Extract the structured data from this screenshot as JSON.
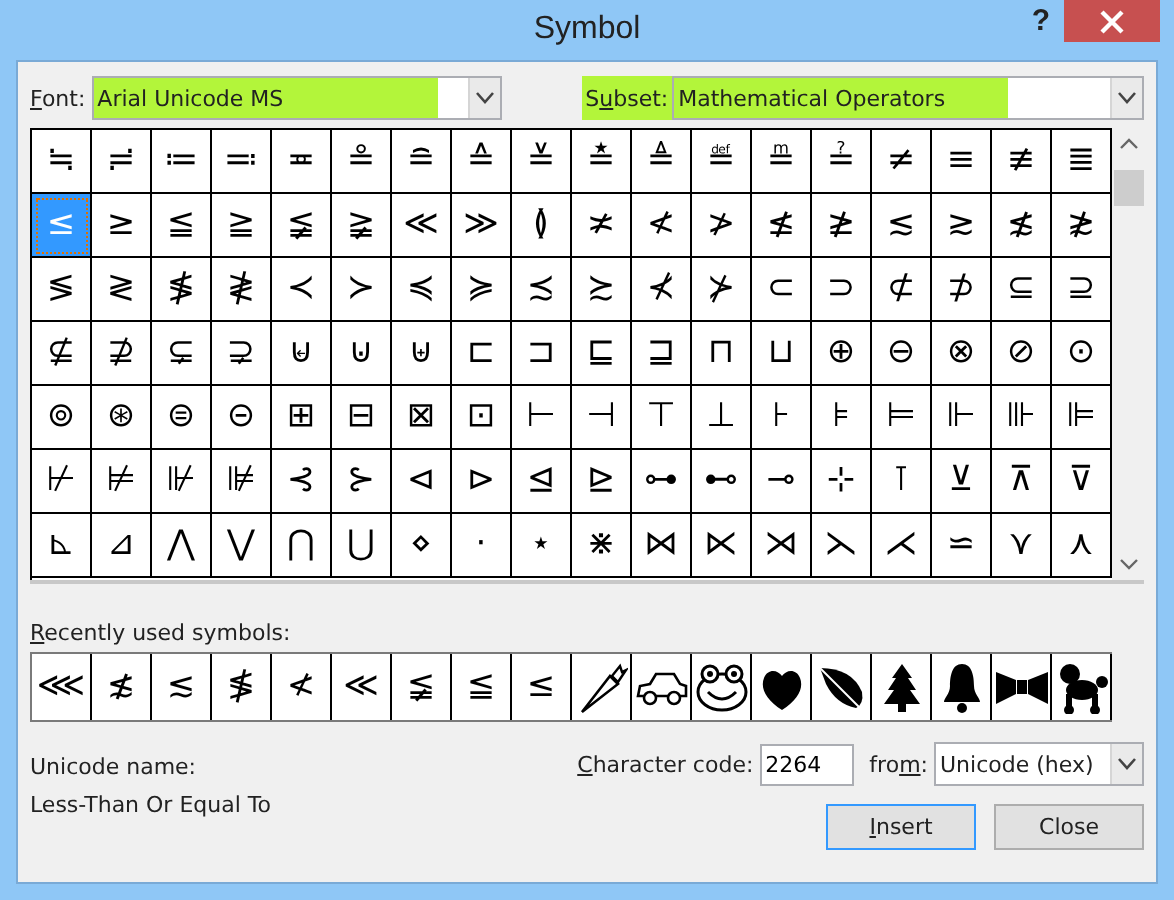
{
  "window": {
    "title": "Symbol",
    "help": "?"
  },
  "font": {
    "label": {
      "key": "F",
      "after": "ont:"
    },
    "value": "Arial Unicode MS"
  },
  "subset": {
    "label": {
      "before": "S",
      "key": "u",
      "after": "bset:"
    },
    "value": "Mathematical Operators"
  },
  "grid": [
    [
      {
        "symbol": "≒",
        "selected": false
      },
      {
        "symbol": "≓",
        "selected": false
      },
      {
        "symbol": "≔",
        "selected": false
      },
      {
        "symbol": "≕",
        "selected": false
      },
      {
        "symbol": "≖",
        "selected": false
      },
      {
        "symbol": "≗",
        "selected": false
      },
      {
        "symbol": "≘",
        "selected": false
      },
      {
        "symbol": "≙",
        "selected": false
      },
      {
        "symbol": "≚",
        "selected": false
      },
      {
        "symbol": "≛",
        "selected": false
      },
      {
        "symbol": "≜",
        "selected": false
      },
      {
        "symbol": "≝",
        "selected": false
      },
      {
        "symbol": "≞",
        "selected": false
      },
      {
        "symbol": "≟",
        "selected": false
      },
      {
        "symbol": "≠",
        "selected": false
      },
      {
        "symbol": "≡",
        "selected": false
      },
      {
        "symbol": "≢",
        "selected": false
      },
      {
        "symbol": "≣",
        "selected": false
      }
    ],
    [
      {
        "symbol": "≤",
        "selected": true
      },
      {
        "symbol": "≥",
        "selected": false
      },
      {
        "symbol": "≦",
        "selected": false
      },
      {
        "symbol": "≧",
        "selected": false
      },
      {
        "symbol": "≨",
        "selected": false
      },
      {
        "symbol": "≩",
        "selected": false
      },
      {
        "symbol": "≪",
        "selected": false
      },
      {
        "symbol": "≫",
        "selected": false
      },
      {
        "symbol": "≬",
        "selected": false
      },
      {
        "symbol": "≭",
        "selected": false
      },
      {
        "symbol": "≮",
        "selected": false
      },
      {
        "symbol": "≯",
        "selected": false
      },
      {
        "symbol": "≰",
        "selected": false
      },
      {
        "symbol": "≱",
        "selected": false
      },
      {
        "symbol": "≲",
        "selected": false
      },
      {
        "symbol": "≳",
        "selected": false
      },
      {
        "symbol": "≴",
        "selected": false
      },
      {
        "symbol": "≵",
        "selected": false
      }
    ],
    [
      {
        "symbol": "≶",
        "selected": false
      },
      {
        "symbol": "≷",
        "selected": false
      },
      {
        "symbol": "≸",
        "selected": false
      },
      {
        "symbol": "≹",
        "selected": false
      },
      {
        "symbol": "≺",
        "selected": false
      },
      {
        "symbol": "≻",
        "selected": false
      },
      {
        "symbol": "≼",
        "selected": false
      },
      {
        "symbol": "≽",
        "selected": false
      },
      {
        "symbol": "≾",
        "selected": false
      },
      {
        "symbol": "≿",
        "selected": false
      },
      {
        "symbol": "⊀",
        "selected": false
      },
      {
        "symbol": "⊁",
        "selected": false
      },
      {
        "symbol": "⊂",
        "selected": false
      },
      {
        "symbol": "⊃",
        "selected": false
      },
      {
        "symbol": "⊄",
        "selected": false
      },
      {
        "symbol": "⊅",
        "selected": false
      },
      {
        "symbol": "⊆",
        "selected": false
      },
      {
        "symbol": "⊇",
        "selected": false
      }
    ],
    [
      {
        "symbol": "⊈",
        "selected": false
      },
      {
        "symbol": "⊉",
        "selected": false
      },
      {
        "symbol": "⊊",
        "selected": false
      },
      {
        "symbol": "⊋",
        "selected": false
      },
      {
        "symbol": "⊌",
        "selected": false
      },
      {
        "symbol": "⊍",
        "selected": false
      },
      {
        "symbol": "⊎",
        "selected": false
      },
      {
        "symbol": "⊏",
        "selected": false
      },
      {
        "symbol": "⊐",
        "selected": false
      },
      {
        "symbol": "⊑",
        "selected": false
      },
      {
        "symbol": "⊒",
        "selected": false
      },
      {
        "symbol": "⊓",
        "selected": false
      },
      {
        "symbol": "⊔",
        "selected": false
      },
      {
        "symbol": "⊕",
        "selected": false
      },
      {
        "symbol": "⊖",
        "selected": false
      },
      {
        "symbol": "⊗",
        "selected": false
      },
      {
        "symbol": "⊘",
        "selected": false
      },
      {
        "symbol": "⊙",
        "selected": false
      }
    ],
    [
      {
        "symbol": "⊚",
        "selected": false
      },
      {
        "symbol": "⊛",
        "selected": false
      },
      {
        "symbol": "⊜",
        "selected": false
      },
      {
        "symbol": "⊝",
        "selected": false
      },
      {
        "symbol": "⊞",
        "selected": false
      },
      {
        "symbol": "⊟",
        "selected": false
      },
      {
        "symbol": "⊠",
        "selected": false
      },
      {
        "symbol": "⊡",
        "selected": false
      },
      {
        "symbol": "⊢",
        "selected": false
      },
      {
        "symbol": "⊣",
        "selected": false
      },
      {
        "symbol": "⊤",
        "selected": false
      },
      {
        "symbol": "⊥",
        "selected": false
      },
      {
        "symbol": "⊦",
        "selected": false
      },
      {
        "symbol": "⊧",
        "selected": false
      },
      {
        "symbol": "⊨",
        "selected": false
      },
      {
        "symbol": "⊩",
        "selected": false
      },
      {
        "symbol": "⊪",
        "selected": false
      },
      {
        "symbol": "⊫",
        "selected": false
      }
    ],
    [
      {
        "symbol": "⊬",
        "selected": false
      },
      {
        "symbol": "⊭",
        "selected": false
      },
      {
        "symbol": "⊮",
        "selected": false
      },
      {
        "symbol": "⊯",
        "selected": false
      },
      {
        "symbol": "⊰",
        "selected": false
      },
      {
        "symbol": "⊱",
        "selected": false
      },
      {
        "symbol": "⊲",
        "selected": false
      },
      {
        "symbol": "⊳",
        "selected": false
      },
      {
        "symbol": "⊴",
        "selected": false
      },
      {
        "symbol": "⊵",
        "selected": false
      },
      {
        "symbol": "⊶",
        "selected": false
      },
      {
        "symbol": "⊷",
        "selected": false
      },
      {
        "symbol": "⊸",
        "selected": false
      },
      {
        "symbol": "⊹",
        "selected": false
      },
      {
        "symbol": "⊺",
        "selected": false
      },
      {
        "symbol": "⊻",
        "selected": false
      },
      {
        "symbol": "⊼",
        "selected": false
      },
      {
        "symbol": "⊽",
        "selected": false
      }
    ],
    [
      {
        "symbol": "⊾",
        "selected": false
      },
      {
        "symbol": "⊿",
        "selected": false
      },
      {
        "symbol": "⋀",
        "selected": false
      },
      {
        "symbol": "⋁",
        "selected": false
      },
      {
        "symbol": "⋂",
        "selected": false
      },
      {
        "symbol": "⋃",
        "selected": false
      },
      {
        "symbol": "⋄",
        "selected": false
      },
      {
        "symbol": "⋅",
        "selected": false
      },
      {
        "symbol": "⋆",
        "selected": false
      },
      {
        "symbol": "⋇",
        "selected": false
      },
      {
        "symbol": "⋈",
        "selected": false
      },
      {
        "symbol": "⋉",
        "selected": false
      },
      {
        "symbol": "⋊",
        "selected": false
      },
      {
        "symbol": "⋋",
        "selected": false
      },
      {
        "symbol": "⋌",
        "selected": false
      },
      {
        "symbol": "⋍",
        "selected": false
      },
      {
        "symbol": "⋎",
        "selected": false
      },
      {
        "symbol": "⋏",
        "selected": false
      }
    ]
  ],
  "recent": {
    "label": {
      "key": "R",
      "after": "ecently used symbols:"
    },
    "items": [
      {
        "kind": "glyph",
        "symbol": "⋘"
      },
      {
        "kind": "glyph",
        "symbol": "≴"
      },
      {
        "kind": "glyph",
        "symbol": "≲"
      },
      {
        "kind": "glyph",
        "symbol": "≸"
      },
      {
        "kind": "glyph",
        "symbol": "≮"
      },
      {
        "kind": "glyph",
        "symbol": "≪"
      },
      {
        "kind": "glyph",
        "symbol": "≨"
      },
      {
        "kind": "glyph",
        "symbol": "≦"
      },
      {
        "kind": "glyph",
        "symbol": "≤"
      },
      {
        "kind": "icon"
      },
      {
        "kind": "icon"
      },
      {
        "kind": "icon"
      },
      {
        "kind": "icon"
      },
      {
        "kind": "icon"
      },
      {
        "kind": "icon"
      },
      {
        "kind": "icon"
      },
      {
        "kind": "icon"
      },
      {
        "kind": "icon"
      }
    ]
  },
  "unicode_name": {
    "label": "Unicode name:",
    "value": "Less-Than Or Equal To"
  },
  "character_code": {
    "label": {
      "key": "C",
      "after": "haracter code:"
    },
    "value": "2264"
  },
  "from": {
    "label": {
      "before": "fro",
      "key": "m",
      "after": ":"
    },
    "value": "Unicode (hex)"
  },
  "buttons": [
    {
      "label": {
        "key": "I",
        "after": "nsert"
      },
      "default": true
    },
    {
      "label": {
        "before": "Close"
      },
      "default": false
    }
  ]
}
